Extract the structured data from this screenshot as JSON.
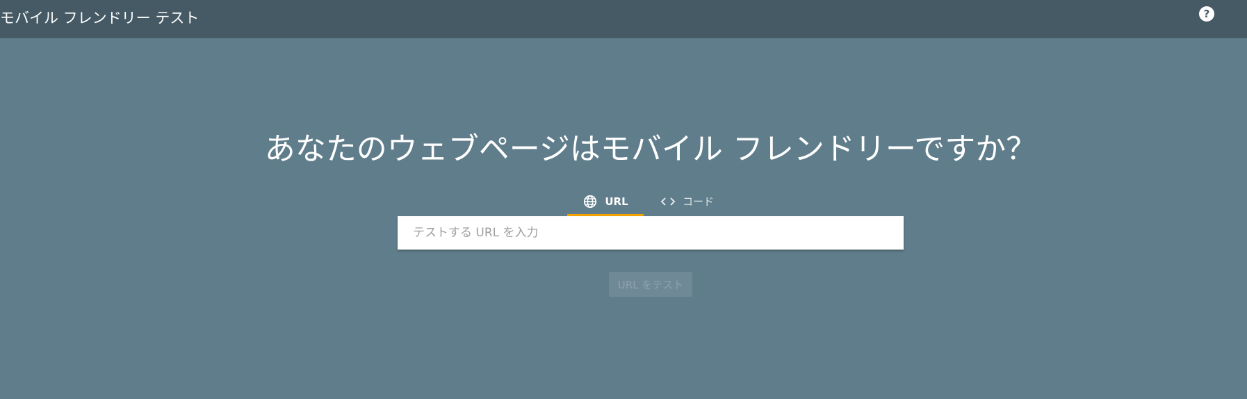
{
  "header": {
    "app_title": "モバイル フレンドリー テスト",
    "help_label": "?"
  },
  "main": {
    "headline": "あなたのウェブページはモバイル フレンドリーですか？",
    "tabs": [
      {
        "label": "URL",
        "icon": "globe-icon",
        "active": true
      },
      {
        "label": "コード",
        "icon": "code-icon",
        "active": false
      }
    ],
    "url_input": {
      "value": "",
      "placeholder": "テストする URL を入力"
    },
    "test_button_label": "URL をテスト"
  },
  "colors": {
    "background": "#607d8b",
    "topbar": "#455a64",
    "active_tab_indicator": "#f4a300",
    "input_bg": "#ffffff"
  }
}
